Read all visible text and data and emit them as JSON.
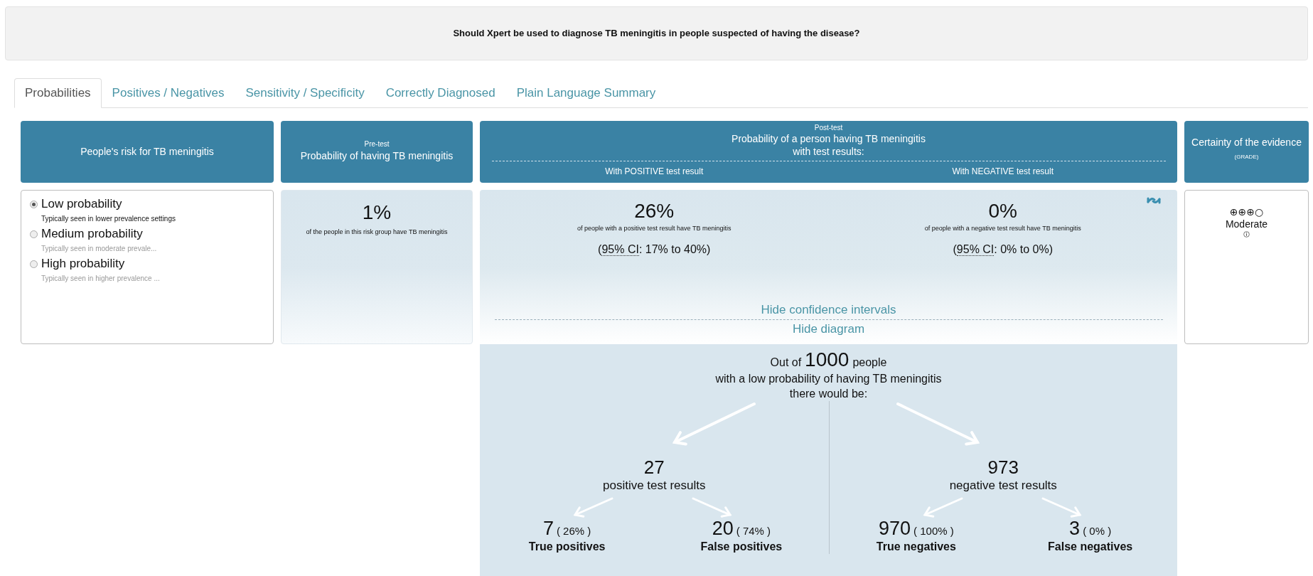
{
  "question": "Should Xpert be used to diagnose TB meningitis in people suspected of having the disease?",
  "tabs": [
    {
      "label": "Probabilities",
      "selected": true
    },
    {
      "label": "Positives / Negatives",
      "selected": false
    },
    {
      "label": "Sensitivity / Specificity",
      "selected": false
    },
    {
      "label": "Correctly Diagnosed",
      "selected": false
    },
    {
      "label": "Plain Language Summary",
      "selected": false
    }
  ],
  "risk": {
    "header": "People's risk for TB meningitis",
    "options": [
      {
        "label": "Low probability",
        "note": "Typically seen in lower prevalence settings",
        "selected": true
      },
      {
        "label": "Medium probability",
        "note": "Typically seen in moderate prevale...",
        "selected": false
      },
      {
        "label": "High probability",
        "note": "Typically seen in higher prevalence ...",
        "selected": false
      }
    ]
  },
  "pretest": {
    "overline": "Pre-test",
    "title": "Probability of having TB meningitis",
    "value": "1%",
    "caption": "of the people in this risk group have TB meningitis"
  },
  "posttest": {
    "overline": "Post-test",
    "title_lines": [
      "Probability of a person having TB meningitis",
      "with test results:"
    ],
    "results": [
      {
        "heading": "With POSITIVE test result",
        "value": "26%",
        "caption": "of people with a positive test result have TB meningitis",
        "ci_open": "(",
        "ci_abbr": "95% CI",
        "ci_rest": ": 17% to 40%)"
      },
      {
        "heading": "With NEGATIVE test result",
        "value": "0%",
        "caption": "of people with a negative test result have TB meningitis",
        "ci_open": "(",
        "ci_abbr": "95% CI",
        "ci_rest": ": 0% to 0%)"
      }
    ],
    "links": [
      "Hide confidence intervals",
      "Hide diagram"
    ]
  },
  "certainty": {
    "title": "Certainty of the evidence",
    "subtitle": "(GRADE)",
    "rating": "⊕⊕⊕○",
    "label": "Moderate"
  },
  "diagram": {
    "intro_prefix": "Out of",
    "total": "1000",
    "intro_suffix": "people",
    "lines": [
      "with a low probability of having TB meningitis",
      "there would be:"
    ],
    "branches": [
      {
        "count": "27",
        "label": "positive test results",
        "outcomes": [
          {
            "count": "7",
            "percent": "( 26% )",
            "label": "True positives"
          },
          {
            "count": "20",
            "percent": "( 74% )",
            "label": "False positives"
          }
        ]
      },
      {
        "count": "973",
        "label": "negative test results",
        "outcomes": [
          {
            "count": "970",
            "percent": "( 100% )",
            "label": "True negatives"
          },
          {
            "count": "3",
            "percent": "( 0% )",
            "label": "False negatives"
          }
        ]
      }
    ]
  }
}
